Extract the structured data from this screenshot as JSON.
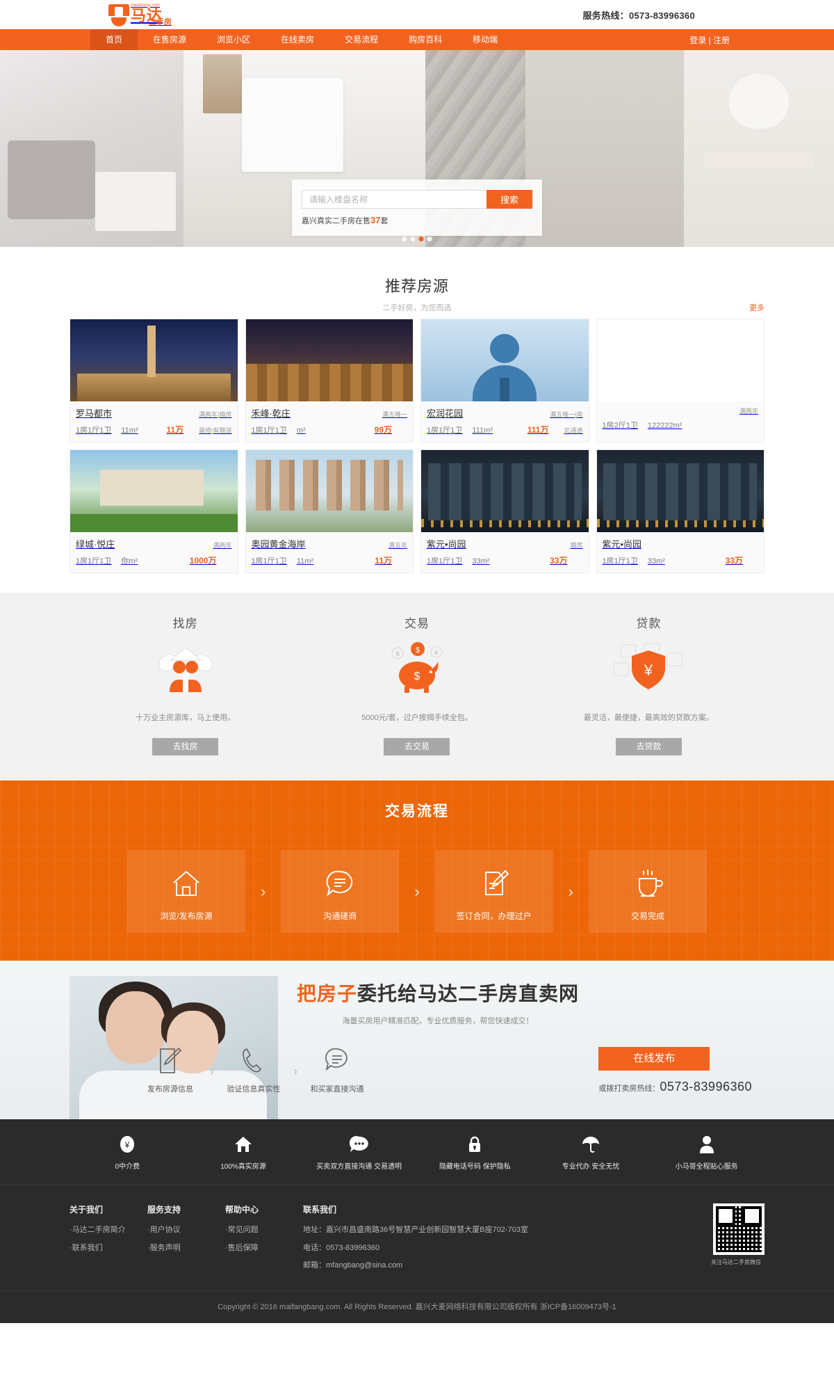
{
  "header": {
    "logo_domain": "madafang.com",
    "logo_main": "马达",
    "logo_sub": "二手房",
    "hotline": "服务热线：0573-83996360"
  },
  "nav": {
    "items": [
      {
        "label": "首页",
        "active": true
      },
      {
        "label": "在售房源",
        "active": false
      },
      {
        "label": "浏览小区",
        "active": false
      },
      {
        "label": "在线卖房",
        "active": false
      },
      {
        "label": "交易流程",
        "active": false
      },
      {
        "label": "购房百科",
        "active": false
      },
      {
        "label": "移动端",
        "active": false
      }
    ],
    "auth": "登录 | 注册"
  },
  "hero": {
    "search_placeholder": "请输入楼盘名称",
    "search_value": "",
    "search_button": "搜索",
    "note_prefix": "嘉兴真实二手房在售",
    "note_count": "37",
    "note_suffix": "套",
    "slide_count": 4,
    "active_slide": 3
  },
  "listings": {
    "title": "推荐房源",
    "subtitle": "二手好房，为您而选",
    "more": "更多",
    "cards": [
      {
        "name": "罗马都市",
        "tag": "满两年|婚房",
        "layout": "1房1厅1卫",
        "area": "11m²",
        "price": "11万",
        "tag2": "装修|有赠送",
        "theme": "im-rome"
      },
      {
        "name": "禾峰·乾庄",
        "tag": "满五唯一",
        "layout": "1房1厅1卫",
        "area": "m²",
        "price": "99万",
        "tag2": "",
        "theme": "im-street"
      },
      {
        "name": "宏润花园",
        "tag": "满五唯一|南",
        "layout": "1房1厅1卫",
        "area": "111m²",
        "price": "111万",
        "tag2": "北通透",
        "theme": "im-avatar"
      },
      {
        "name": "",
        "tag": "满两年",
        "layout": "1房2厅1卫",
        "area": "122222m²",
        "price": "",
        "tag2": "",
        "theme": "card-empty"
      },
      {
        "name": "绿城·悦庄",
        "tag": "满两年",
        "layout": "1房1厅1卫",
        "area": "你m²",
        "price": "1000万",
        "tag2": "",
        "theme": "im-villa"
      },
      {
        "name": "奥园黄金海岸",
        "tag": "满五年",
        "layout": "1房1厅1卫",
        "area": "11m²",
        "price": "11万",
        "tag2": "",
        "theme": "im-towers"
      },
      {
        "name": "紫元•尚园",
        "tag": "婚房",
        "layout": "1房1厅1卫",
        "area": "33m²",
        "price": "33万",
        "tag2": "",
        "theme": "im-night"
      },
      {
        "name": "紫元•尚园",
        "tag": "",
        "layout": "1房1厅1卫",
        "area": "33m²",
        "price": "33万",
        "tag2": "",
        "theme": "im-night"
      }
    ]
  },
  "services": [
    {
      "title": "找房",
      "icon": "house-handshake-icon",
      "desc": "十万业主房源库，马上使用。",
      "button": "去找房"
    },
    {
      "title": "交易",
      "icon": "piggy-bank-icon",
      "desc": "5000元/套，过户按揭手续全包。",
      "button": "去交易"
    },
    {
      "title": "贷款",
      "icon": "yuan-shield-icon",
      "desc": "最灵活，最便捷，最高效的贷款方案。",
      "button": "去贷款"
    }
  ],
  "flow": {
    "title": "交易流程",
    "arrow": "›",
    "steps": [
      {
        "label": "浏览/发布房源",
        "icon": "home-icon"
      },
      {
        "label": "沟通磋商",
        "icon": "chat-bubble-icon"
      },
      {
        "label": "签订合同，办理过户",
        "icon": "contract-pen-icon"
      },
      {
        "label": "交易完成",
        "icon": "coffee-cup-icon"
      }
    ]
  },
  "cta": {
    "title_highlight": "把房子",
    "title_rest": "委托给马达二手房直卖网",
    "subtitle": "海量买房用户精准匹配，专业优质服务，帮您快速成交！",
    "arrow": "›",
    "steps": [
      {
        "label": "发布房源信息",
        "icon": "edit-document-icon"
      },
      {
        "label": "验证信息真实性",
        "icon": "phone-icon"
      },
      {
        "label": "和买家直接沟通",
        "icon": "chat-bubble-icon"
      }
    ],
    "button": "在线发布",
    "phone_label": "或拨打卖房热线：",
    "phone_number": "0573-83996360"
  },
  "features": [
    {
      "label": "0中介费",
      "icon": "yuan-coin-icon"
    },
    {
      "label": "100%真实房源",
      "icon": "home-icon"
    },
    {
      "label": "买卖双方直接沟通 交易透明",
      "icon": "chat-bubble-icon"
    },
    {
      "label": "隐藏电话号码 保护隐私",
      "icon": "lock-icon"
    },
    {
      "label": "专业代办 安全无忧",
      "icon": "umbrella-icon"
    },
    {
      "label": "小马哥全程贴心服务",
      "icon": "user-icon"
    }
  ],
  "footer": {
    "columns": [
      {
        "title": "关于我们",
        "links": [
          "·马达二手房简介",
          "·联系我们"
        ]
      },
      {
        "title": "服务支持",
        "links": [
          "·用户协议",
          "·服务声明"
        ]
      },
      {
        "title": "帮助中心",
        "links": [
          "·常见问题",
          "·售后保障"
        ]
      }
    ],
    "contact": {
      "title": "联系我们",
      "address": "地址：嘉兴市昌盛南路36号智慧产业创新园智慧大厦B座702-703室",
      "phone": "电话：0573-83996360",
      "email": "邮箱：mfangbang@sina.com"
    },
    "qr_caption": "关注马达二手房微信",
    "copyright": "Copyright © 2016 maifangbang.com. All Rights Reserved. 嘉兴大麦网络科技有限公司版权所有 浙ICP备16009473号-1"
  },
  "colors": {
    "brand": "#f2621f",
    "flow_bg": "#ec6608",
    "footer_bg": "#2b2b2b"
  }
}
